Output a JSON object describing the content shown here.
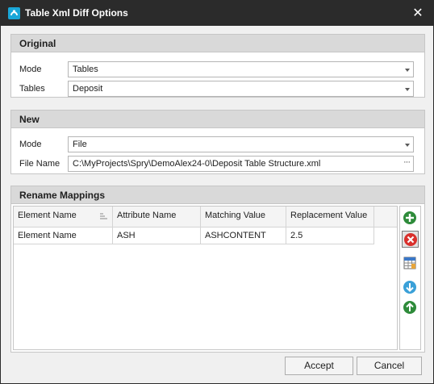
{
  "window": {
    "title": "Table Xml Diff Options"
  },
  "original": {
    "header": "Original",
    "mode_label": "Mode",
    "mode_value": "Tables",
    "tables_label": "Tables",
    "tables_value": "Deposit"
  },
  "new": {
    "header": "New",
    "mode_label": "Mode",
    "mode_value": "File",
    "file_label": "File Name",
    "file_value": "C:\\MyProjects\\Spry\\DemoAlex24-0\\Deposit Table Structure.xml",
    "browse_label": "···"
  },
  "mappings": {
    "header": "Rename Mappings",
    "columns": [
      "Element Name",
      "Attribute Name",
      "Matching Value",
      "Replacement Value"
    ],
    "rows": [
      [
        "Element Name",
        "ASH",
        "ASHCONTENT",
        "2.5"
      ]
    ],
    "toolbar_icons": [
      "add-icon",
      "delete-icon",
      "grid-icon",
      "move-down-icon",
      "move-up-icon"
    ]
  },
  "buttons": {
    "accept": "Accept",
    "cancel": "Cancel"
  },
  "colors": {
    "titlebar": "#2b2b2b",
    "add": "#2e8b3a",
    "delete": "#d9302c",
    "move": "#3aa0d8"
  }
}
